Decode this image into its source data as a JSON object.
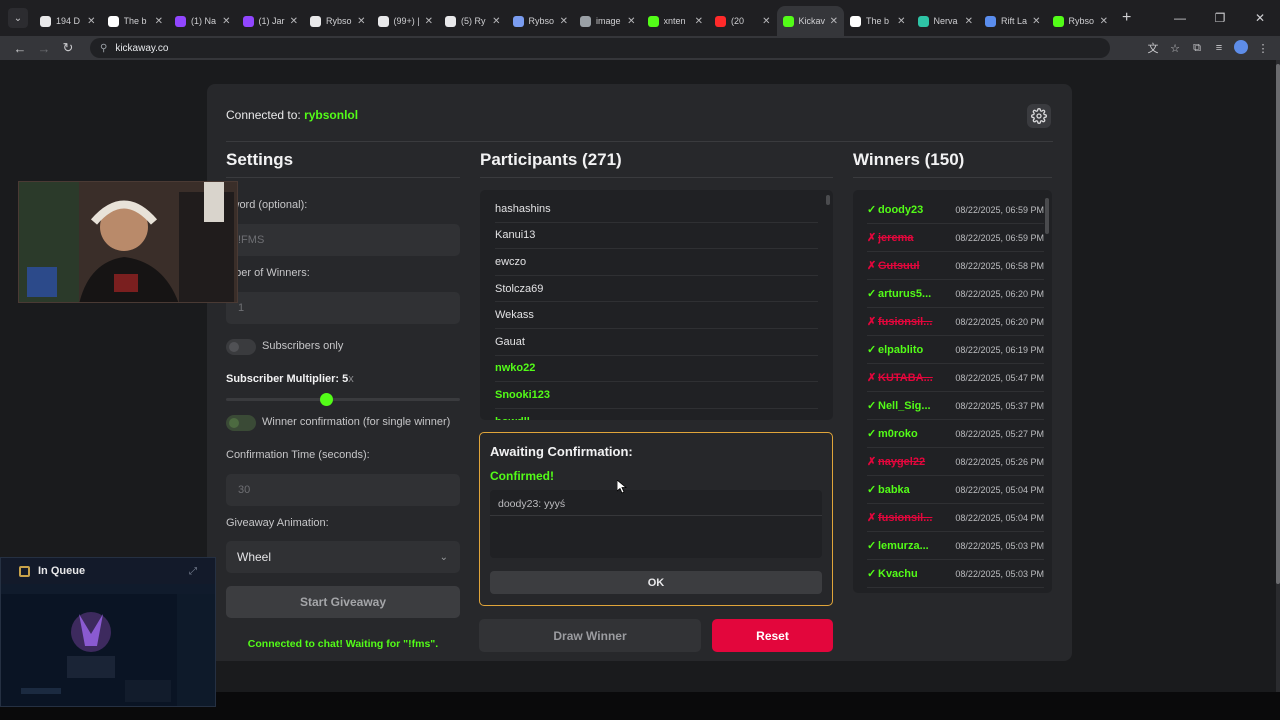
{
  "browser": {
    "tabs": [
      {
        "label": "194 D",
        "color": "#e8e8ea"
      },
      {
        "label": "The b",
        "color": "#ffffff"
      },
      {
        "label": "(1) Na",
        "color": "#9146ff"
      },
      {
        "label": "(1) Jar",
        "color": "#9146ff"
      },
      {
        "label": "Rybso",
        "color": "#e8e8ea"
      },
      {
        "label": "(99+) |",
        "color": "#e8e8ea"
      },
      {
        "label": "(5) Ry",
        "color": "#e8e8ea"
      },
      {
        "label": "Rybso",
        "color": "#7a9cf0"
      },
      {
        "label": "image",
        "color": "#9aa0a6"
      },
      {
        "label": "xnten",
        "color": "#53fc18"
      },
      {
        "label": "(20",
        "color": "#ff2a2a"
      },
      {
        "label": "Kickav",
        "color": "#53fc18",
        "active": true
      },
      {
        "label": "The b",
        "color": "#ffffff"
      },
      {
        "label": "Nerva",
        "color": "#2ec4a6"
      },
      {
        "label": "Rift La",
        "color": "#5a8dee"
      },
      {
        "label": "Rybso",
        "color": "#53fc18"
      }
    ],
    "url": "kickaway.co"
  },
  "header": {
    "connected_label": "Connected to:",
    "channel": "rybsonlol"
  },
  "settings": {
    "title": "Settings",
    "keyword_label": "yword (optional):",
    "keyword_placeholder": "!FMS",
    "winners_label": "mber of Winners:",
    "winners_value": "1",
    "subscribers_only_label": "Subscribers only",
    "multiplier_label": "Subscriber Multiplier:",
    "multiplier_value": "5",
    "multiplier_unit": "x",
    "multiplier_level": 0.43,
    "winner_confirmation_label": "Winner confirmation (for single winner)",
    "confirmation_time_label": "Confirmation Time (seconds):",
    "confirmation_time_value": "30",
    "animation_label": "Giveaway Animation:",
    "animation_value": "Wheel",
    "start_button": "Start Giveaway",
    "status": "Connected to chat! Waiting for \"!fms\"."
  },
  "participants": {
    "title": "Participants (271)",
    "list": [
      {
        "name": "hashashins",
        "subscriber": false
      },
      {
        "name": "Kanui13",
        "subscriber": false
      },
      {
        "name": "ewczo",
        "subscriber": false
      },
      {
        "name": "Stolcza69",
        "subscriber": false
      },
      {
        "name": "Wekass",
        "subscriber": false
      },
      {
        "name": "Gauat",
        "subscriber": false
      },
      {
        "name": "nwko22",
        "subscriber": true
      },
      {
        "name": "Snooki123",
        "subscriber": true
      },
      {
        "name": "bowdll",
        "subscriber": true
      }
    ]
  },
  "confirmation": {
    "title": "Awaiting Confirmation:",
    "status": "Confirmed!",
    "message": "doody23: yyyś",
    "ok_button": "OK"
  },
  "actions": {
    "draw_button": "Draw Winner",
    "reset_button": "Reset"
  },
  "winners": {
    "title": "Winners (150)",
    "list": [
      {
        "mark": "✓",
        "name": "doody23",
        "time": "08/22/2025, 06:59 PM",
        "confirmed": true
      },
      {
        "mark": "✗",
        "name": "jerema",
        "time": "08/22/2025, 06:59 PM",
        "confirmed": false
      },
      {
        "mark": "✗",
        "name": "Gutsuul",
        "time": "08/22/2025, 06:58 PM",
        "confirmed": false
      },
      {
        "mark": "✓",
        "name": "arturus5...",
        "time": "08/22/2025, 06:20 PM",
        "confirmed": true
      },
      {
        "mark": "✗",
        "name": "fusionsil...",
        "time": "08/22/2025, 06:20 PM",
        "confirmed": false
      },
      {
        "mark": "✓",
        "name": "elpablito",
        "time": "08/22/2025, 06:19 PM",
        "confirmed": true
      },
      {
        "mark": "✗",
        "name": "KUTABA...",
        "time": "08/22/2025, 05:47 PM",
        "confirmed": false
      },
      {
        "mark": "✓",
        "name": "Nell_Sig...",
        "time": "08/22/2025, 05:37 PM",
        "confirmed": true
      },
      {
        "mark": "✓",
        "name": "m0roko",
        "time": "08/22/2025, 05:27 PM",
        "confirmed": true
      },
      {
        "mark": "✗",
        "name": "naygel22",
        "time": "08/22/2025, 05:26 PM",
        "confirmed": false
      },
      {
        "mark": "✓",
        "name": "babka",
        "time": "08/22/2025, 05:04 PM",
        "confirmed": true
      },
      {
        "mark": "✗",
        "name": "fusionsil...",
        "time": "08/22/2025, 05:04 PM",
        "confirmed": false
      },
      {
        "mark": "✓",
        "name": "lemurza...",
        "time": "08/22/2025, 05:03 PM",
        "confirmed": true
      },
      {
        "mark": "✓",
        "name": "Kvachu",
        "time": "08/22/2025, 05:03 PM",
        "confirmed": true
      }
    ]
  },
  "overlay": {
    "queue_title": "In Queue"
  },
  "colors": {
    "kick_green": "#53fc18",
    "reset_red": "#e3063c",
    "confirm_border": "#e0a53a"
  }
}
